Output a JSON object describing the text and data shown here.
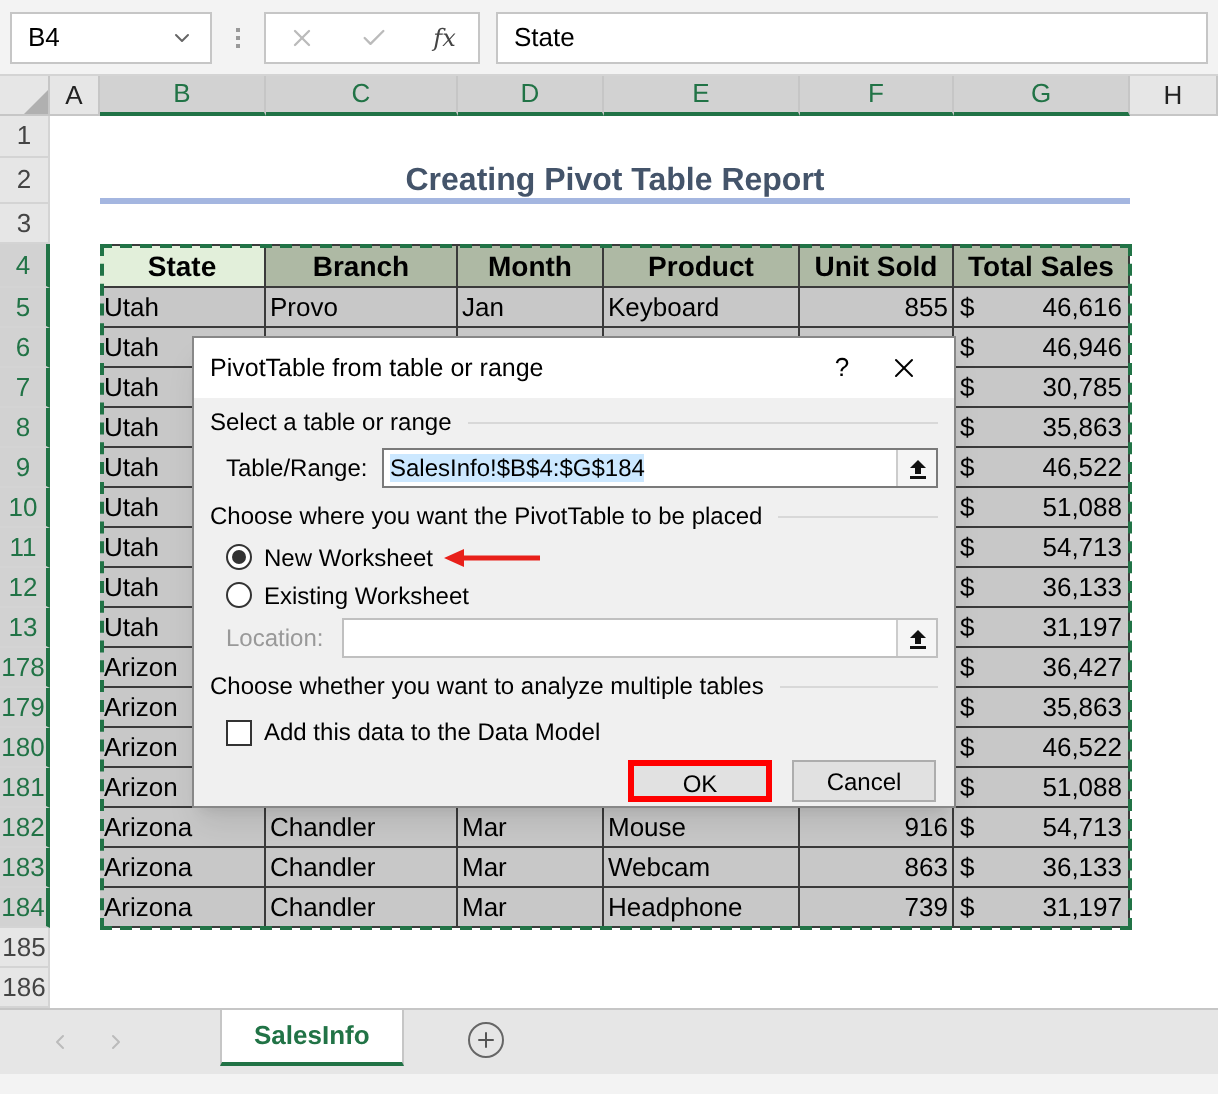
{
  "formula_bar": {
    "name_box": "B4",
    "function_label": "fx",
    "content": "State"
  },
  "column_headers": [
    {
      "label": "A",
      "selected": false
    },
    {
      "label": "B",
      "selected": true
    },
    {
      "label": "C",
      "selected": true
    },
    {
      "label": "D",
      "selected": true
    },
    {
      "label": "E",
      "selected": true
    },
    {
      "label": "F",
      "selected": true
    },
    {
      "label": "G",
      "selected": true
    },
    {
      "label": "H",
      "selected": false
    }
  ],
  "sheet": {
    "title": "Creating Pivot Table Report",
    "rows_above": [
      {
        "row": "1",
        "selected": false
      },
      {
        "row": "2",
        "selected": false
      },
      {
        "row": "3",
        "selected": false
      }
    ],
    "header_row": {
      "row": "4",
      "selected": true,
      "cells": [
        "State",
        "Branch",
        "Month",
        "Product",
        "Unit Sold",
        "Total Sales"
      ]
    },
    "rows": [
      {
        "row": "5",
        "selected": true,
        "cells": [
          "Utah",
          "Provo",
          "Jan",
          "Keyboard",
          "855"
        ],
        "currency": "$",
        "total": "46,616"
      },
      {
        "row": "6",
        "selected": true,
        "cells": [
          "Utah"
        ],
        "currency": "$",
        "total": "46,946"
      },
      {
        "row": "7",
        "selected": true,
        "cells": [
          "Utah"
        ],
        "currency": "$",
        "total": "30,785"
      },
      {
        "row": "8",
        "selected": true,
        "cells": [
          "Utah"
        ],
        "currency": "$",
        "total": "35,863"
      },
      {
        "row": "9",
        "selected": true,
        "cells": [
          "Utah"
        ],
        "currency": "$",
        "total": "46,522"
      },
      {
        "row": "10",
        "selected": true,
        "cells": [
          "Utah"
        ],
        "currency": "$",
        "total": "51,088"
      },
      {
        "row": "11",
        "selected": true,
        "cells": [
          "Utah"
        ],
        "currency": "$",
        "total": "54,713"
      },
      {
        "row": "12",
        "selected": true,
        "cells": [
          "Utah"
        ],
        "currency": "$",
        "total": "36,133"
      },
      {
        "row": "13",
        "selected": true,
        "cells": [
          "Utah"
        ],
        "currency": "$",
        "total": "31,197"
      },
      {
        "row": "178",
        "selected": true,
        "cells": [
          "Arizon"
        ],
        "currency": "$",
        "total": "36,427"
      },
      {
        "row": "179",
        "selected": true,
        "cells": [
          "Arizon"
        ],
        "currency": "$",
        "total": "35,863"
      },
      {
        "row": "180",
        "selected": true,
        "cells": [
          "Arizon"
        ],
        "currency": "$",
        "total": "46,522"
      },
      {
        "row": "181",
        "selected": true,
        "cells": [
          "Arizon"
        ],
        "currency": "$",
        "total": "51,088"
      },
      {
        "row": "182",
        "selected": true,
        "cells": [
          "Arizona",
          "Chandler",
          "Mar",
          "Mouse",
          "916"
        ],
        "currency": "$",
        "total": "54,713"
      },
      {
        "row": "183",
        "selected": true,
        "cells": [
          "Arizona",
          "Chandler",
          "Mar",
          "Webcam",
          "863"
        ],
        "currency": "$",
        "total": "36,133"
      },
      {
        "row": "184",
        "selected": true,
        "cells": [
          "Arizona",
          "Chandler",
          "Mar",
          "Headphone",
          "739"
        ],
        "currency": "$",
        "total": "31,197"
      }
    ],
    "rows_below": [
      {
        "row": "185",
        "selected": false
      },
      {
        "row": "186",
        "selected": false
      }
    ]
  },
  "dialog": {
    "title": "PivotTable from table or range",
    "help": "?",
    "range_section": "Select a table or range",
    "range_label": "Table/Range:",
    "range_value": "SalesInfo!$B$4:$G$184",
    "place_section": "Choose where you want the PivotTable to be placed",
    "options": [
      {
        "label": "New Worksheet",
        "selected": true,
        "pointer_arrow": true
      },
      {
        "label": "Existing Worksheet",
        "selected": false,
        "pointer_arrow": false
      }
    ],
    "location_label": "Location:",
    "location_disabled": true,
    "tables_section": "Choose whether you want to analyze multiple tables",
    "data_model": {
      "label": "Add this data to the Data Model",
      "checked": false
    },
    "buttons": [
      {
        "label": "OK",
        "highlighted": true
      },
      {
        "label": "Cancel",
        "highlighted": false
      }
    ]
  },
  "sheet_tabs": [
    {
      "label": "SalesInfo",
      "selected": true
    }
  ]
}
